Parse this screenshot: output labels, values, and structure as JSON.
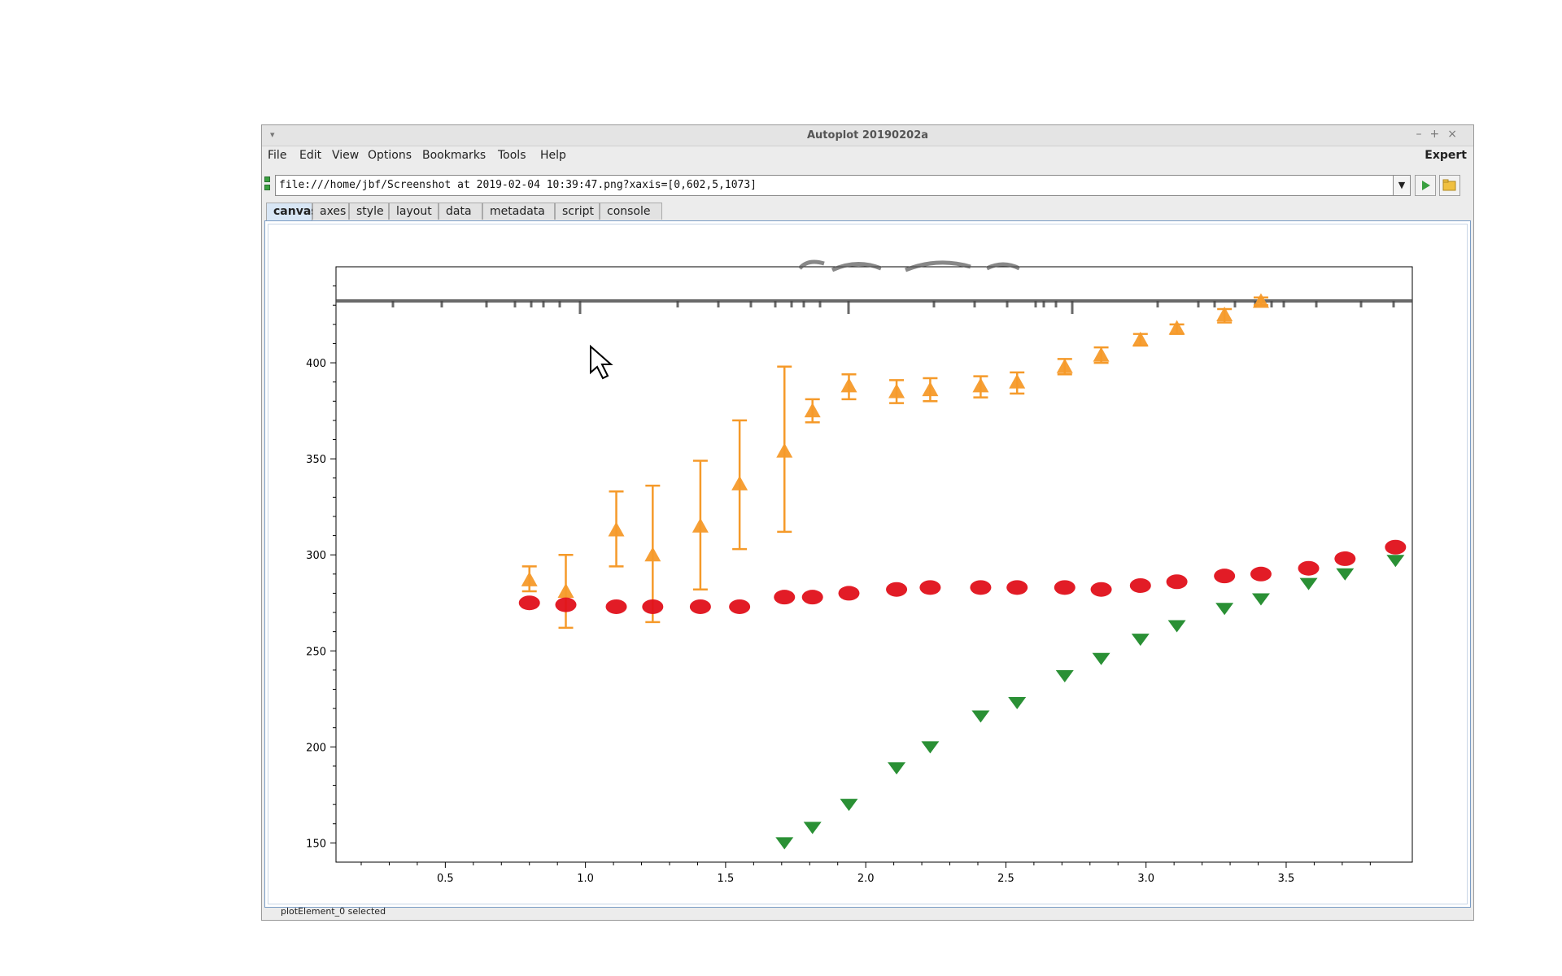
{
  "window": {
    "title": "Autoplot 20190202a"
  },
  "menubar": {
    "items": [
      "File",
      "Edit",
      "View",
      "Options",
      "Bookmarks",
      "Tools",
      "Help"
    ],
    "expert": "Expert"
  },
  "url": {
    "value": "file:///home/jbf/Screenshot at 2019-02-04 10:39:47.png?xaxis=[0,602,5,1073]"
  },
  "tabs": [
    "canvas",
    "axes",
    "style",
    "layout",
    "data",
    "metadata",
    "script",
    "console"
  ],
  "status": {
    "text": "plotElement_0 selected"
  },
  "colors": {
    "orange": "#f59a2a",
    "red": "#e0101a",
    "green": "#1f8a2a",
    "accent": "#d8e6f5"
  },
  "chart_data": {
    "type": "scatter",
    "xlim": [
      0.11,
      3.95
    ],
    "ylim": [
      140,
      450
    ],
    "xticks": [
      0.5,
      1.0,
      1.5,
      2.0,
      2.5,
      3.0,
      3.5
    ],
    "xtick_labels": [
      "0.5",
      "1.0",
      "1.5",
      "2.0",
      "2.5",
      "3.0",
      "3.5"
    ],
    "yticks": [
      150,
      200,
      250,
      300,
      350,
      400
    ],
    "ytick_labels": [
      "150",
      "200",
      "250",
      "300",
      "350",
      "400"
    ],
    "series": [
      {
        "color": "#f59a2a",
        "marker": "triangle-up",
        "points": [
          [
            0.8,
            287,
            294,
            281
          ],
          [
            0.93,
            281,
            300,
            262
          ],
          [
            1.11,
            313,
            333,
            294
          ],
          [
            1.24,
            300,
            336,
            265
          ],
          [
            1.41,
            315,
            349,
            282
          ],
          [
            1.55,
            337,
            370,
            303
          ],
          [
            1.71,
            354,
            398,
            312
          ],
          [
            1.81,
            375,
            381,
            369
          ],
          [
            1.94,
            388,
            394,
            381
          ],
          [
            2.11,
            385,
            391,
            379
          ],
          [
            2.23,
            386,
            392,
            380
          ],
          [
            2.41,
            388,
            393,
            382
          ],
          [
            2.54,
            390,
            395,
            384
          ],
          [
            2.71,
            398,
            402,
            394
          ],
          [
            2.84,
            404,
            408,
            400
          ],
          [
            2.98,
            412,
            415,
            409
          ],
          [
            3.11,
            418,
            420,
            415
          ],
          [
            3.28,
            425,
            428,
            421
          ],
          [
            3.41,
            432,
            434,
            430
          ]
        ]
      },
      {
        "color": "#e0101a",
        "marker": "circle",
        "points": [
          [
            0.8,
            275
          ],
          [
            0.93,
            274
          ],
          [
            1.11,
            273
          ],
          [
            1.24,
            273
          ],
          [
            1.41,
            273
          ],
          [
            1.55,
            273
          ],
          [
            1.71,
            278
          ],
          [
            1.81,
            278
          ],
          [
            1.94,
            280
          ],
          [
            2.11,
            282
          ],
          [
            2.23,
            283
          ],
          [
            2.41,
            283
          ],
          [
            2.54,
            283
          ],
          [
            2.71,
            283
          ],
          [
            2.84,
            282
          ],
          [
            2.98,
            284
          ],
          [
            3.11,
            286
          ],
          [
            3.28,
            289
          ],
          [
            3.41,
            290
          ],
          [
            3.58,
            293
          ],
          [
            3.71,
            298
          ],
          [
            3.89,
            304
          ]
        ]
      },
      {
        "color": "#1f8a2a",
        "marker": "triangle-down",
        "points": [
          [
            1.71,
            150
          ],
          [
            1.81,
            158
          ],
          [
            1.94,
            170
          ],
          [
            2.11,
            189
          ],
          [
            2.23,
            200
          ],
          [
            2.41,
            216
          ],
          [
            2.54,
            223
          ],
          [
            2.71,
            237
          ],
          [
            2.84,
            246
          ],
          [
            2.98,
            256
          ],
          [
            3.11,
            263
          ],
          [
            3.28,
            272
          ],
          [
            3.41,
            277
          ],
          [
            3.58,
            285
          ],
          [
            3.71,
            290
          ],
          [
            3.89,
            297
          ]
        ]
      }
    ],
    "grid": false,
    "legend": "none"
  }
}
